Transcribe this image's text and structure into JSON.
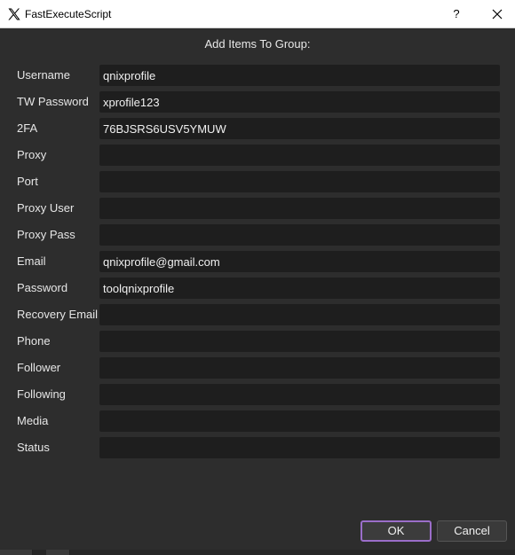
{
  "window": {
    "title": "FastExecuteScript",
    "app_icon": "x-logo-icon",
    "help_label": "?",
    "close_icon": "close-icon"
  },
  "heading": "Add Items To Group:",
  "fields": [
    {
      "label": "Username",
      "value": "qnixprofile"
    },
    {
      "label": "TW Password",
      "value": "xprofile123"
    },
    {
      "label": "2FA",
      "value": "76BJSRS6USV5YMUW"
    },
    {
      "label": "Proxy",
      "value": ""
    },
    {
      "label": "Port",
      "value": ""
    },
    {
      "label": "Proxy User",
      "value": ""
    },
    {
      "label": "Proxy Pass",
      "value": ""
    },
    {
      "label": "Email",
      "value": "qnixprofile@gmail.com"
    },
    {
      "label": "Password",
      "value": "toolqnixprofile"
    },
    {
      "label": "Recovery Email",
      "value": ""
    },
    {
      "label": "Phone",
      "value": ""
    },
    {
      "label": "Follower",
      "value": ""
    },
    {
      "label": "Following",
      "value": ""
    },
    {
      "label": "Media",
      "value": ""
    },
    {
      "label": "Status",
      "value": ""
    }
  ],
  "buttons": {
    "ok_label": "OK",
    "cancel_label": "Cancel"
  },
  "colors": {
    "background": "#2d2d2d",
    "input_background": "#1e1e1e",
    "focus_accent": "#9b6ec9"
  }
}
